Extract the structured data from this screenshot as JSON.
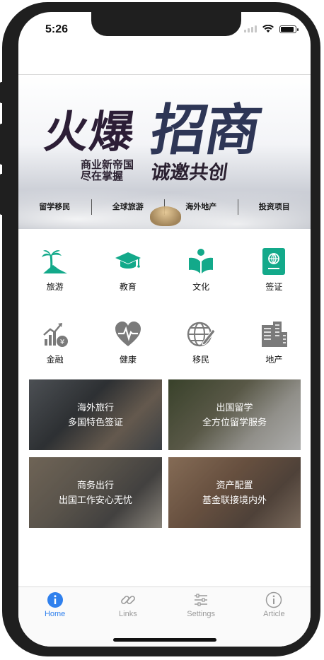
{
  "status_bar": {
    "time": "5:26"
  },
  "banner": {
    "title_left": "火爆",
    "title_right": "招商",
    "subtitle_line1": "商业新帝国",
    "subtitle_line2": "尽在掌握",
    "slogan": "诚邀共创",
    "tags": [
      "留学移民",
      "全球旅游",
      "海外地产",
      "投资项目"
    ]
  },
  "categories": [
    {
      "label": "旅游",
      "icon": "palm-tree-icon"
    },
    {
      "label": "教育",
      "icon": "graduation-cap-icon"
    },
    {
      "label": "文化",
      "icon": "open-book-icon"
    },
    {
      "label": "签证",
      "icon": "passport-icon"
    },
    {
      "label": "金融",
      "icon": "finance-chart-icon"
    },
    {
      "label": "健康",
      "icon": "heartbeat-icon"
    },
    {
      "label": "移民",
      "icon": "globe-pen-icon"
    },
    {
      "label": "地产",
      "icon": "buildings-icon"
    }
  ],
  "cards": [
    {
      "title": "海外旅行",
      "subtitle": "多国特色签证"
    },
    {
      "title": "出国留学",
      "subtitle": "全方位留学服务"
    },
    {
      "title": "商务出行",
      "subtitle": "出国工作安心无忧"
    },
    {
      "title": "资产配置",
      "subtitle": "基金联接境内外"
    }
  ],
  "tabbar": {
    "active_color": "#2f80ed",
    "tabs": [
      {
        "label": "Home",
        "icon": "info-circle-icon",
        "active": true
      },
      {
        "label": "Links",
        "icon": "link-icon",
        "active": false
      },
      {
        "label": "Settings",
        "icon": "sliders-icon",
        "active": false
      },
      {
        "label": "Article",
        "icon": "info-circle-outline-icon",
        "active": false
      }
    ]
  },
  "colors": {
    "accent": "#13a98a",
    "icon_gray": "#7a7a7a"
  }
}
